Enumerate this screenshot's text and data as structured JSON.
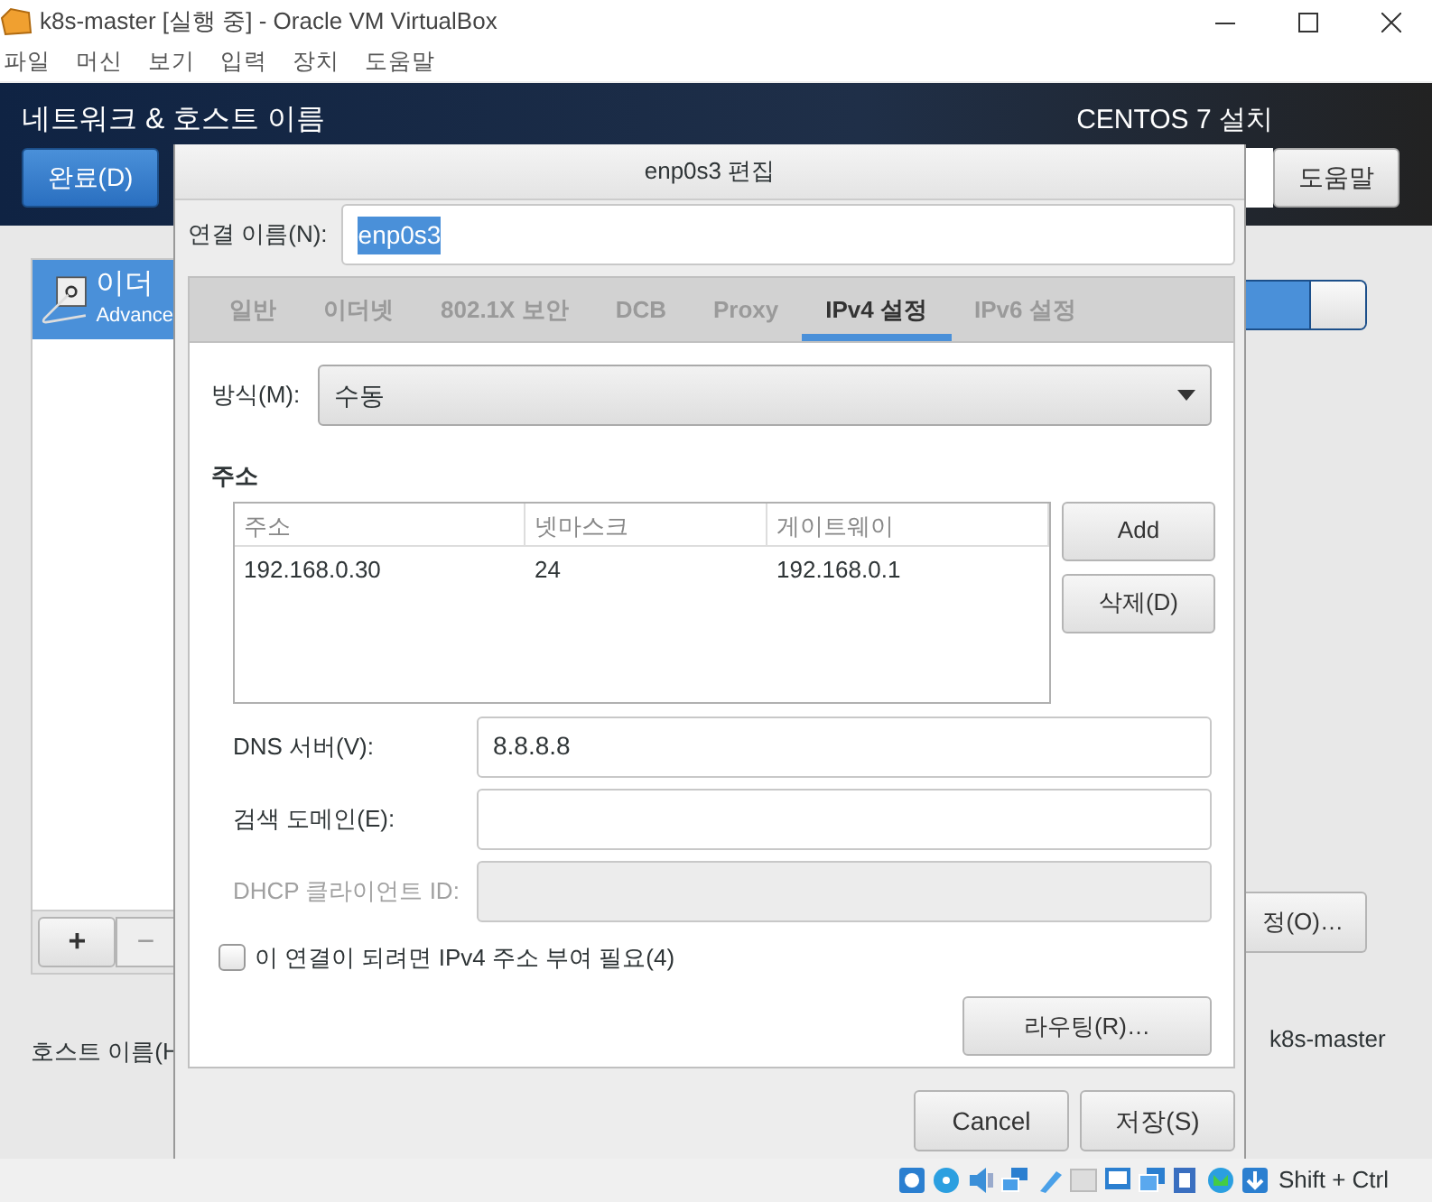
{
  "window": {
    "title": "k8s-master [실행 중] - Oracle VM VirtualBox"
  },
  "menu": [
    "파일",
    "머신",
    "보기",
    "입력",
    "장치",
    "도움말"
  ],
  "installer": {
    "title": "네트워크 & 호스트 이름",
    "done_button": "완료(D)",
    "product": "CENTOS 7 설치",
    "help_button": "도움말",
    "connections": [
      {
        "name": "이더",
        "detail": "Advance",
        "selected": true
      }
    ],
    "add_button": "+",
    "remove_button": "−",
    "toggle": {
      "on": true
    },
    "settings_button": "정(O)…",
    "hostname_label": "호스트 이름(H",
    "hostname": "k8s-master"
  },
  "dialog": {
    "title": "enp0s3 편집",
    "name_label": "연결 이름(N):",
    "name_value": "enp0s3",
    "tabs": [
      {
        "label": "일반",
        "selected": false
      },
      {
        "label": "이더넷",
        "selected": false
      },
      {
        "label": "802.1X 보안",
        "selected": false
      },
      {
        "label": "DCB",
        "selected": false
      },
      {
        "label": "Proxy",
        "selected": false
      },
      {
        "label": "IPv4 설정",
        "selected": true
      },
      {
        "label": "IPv6 설정",
        "selected": false
      }
    ],
    "method": {
      "label": "방식(M):",
      "value": "수동"
    },
    "addresses_heading": "주소",
    "columns": [
      "주소",
      "넷마스크",
      "게이트웨이"
    ],
    "rows": [
      [
        "192.168.0.30",
        "24",
        "192.168.0.1"
      ]
    ],
    "add_button": "Add",
    "delete_button": "삭제(D)",
    "fields": [
      {
        "label": "DNS 서버(V):",
        "value": "8.8.8.8",
        "disabled": false
      },
      {
        "label": "검색 도메인(E):",
        "disabled": false
      },
      {
        "label": "DHCP 클라이언트 ID:",
        "disabled": true
      }
    ],
    "require_ipv4": {
      "label": "이 연결이 되려면 IPv4 주소 부여 필요(4)",
      "checked": false
    },
    "routes_button": "라우팅(R)…",
    "buttons": [
      "Cancel",
      "저장(S)"
    ]
  },
  "status_bar": {
    "host_key": "Shift + Ctrl"
  }
}
